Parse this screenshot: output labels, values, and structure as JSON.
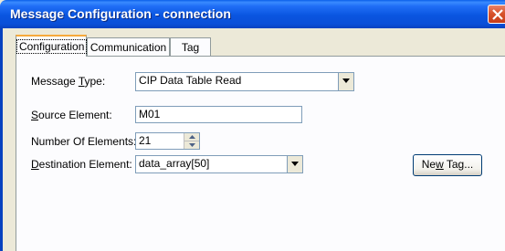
{
  "window": {
    "title": "Message Configuration - connection"
  },
  "tabs": [
    {
      "label": "Configuration",
      "active": true
    },
    {
      "label": "Communication",
      "active": false
    },
    {
      "label": "Tag",
      "active": false
    }
  ],
  "form": {
    "message_type": {
      "label_pre": "Message ",
      "label_u": "T",
      "label_post": "ype:",
      "value": "CIP Data Table Read"
    },
    "source_element": {
      "label_pre": "",
      "label_u": "S",
      "label_post": "ource Element:",
      "value": "M01"
    },
    "number_of_elements": {
      "label": "Number Of Elements:",
      "value": "21"
    },
    "destination_element": {
      "label_pre": "",
      "label_u": "D",
      "label_post": "estination Element:",
      "value": "data_array[50]"
    }
  },
  "buttons": {
    "new_tag_pre": "Ne",
    "new_tag_u": "w",
    "new_tag_post": " Tag..."
  },
  "colors": {
    "titlebar": "#0a55e0",
    "tab_highlight": "#f7a93c",
    "dialog_bg": "#ece9d8"
  }
}
